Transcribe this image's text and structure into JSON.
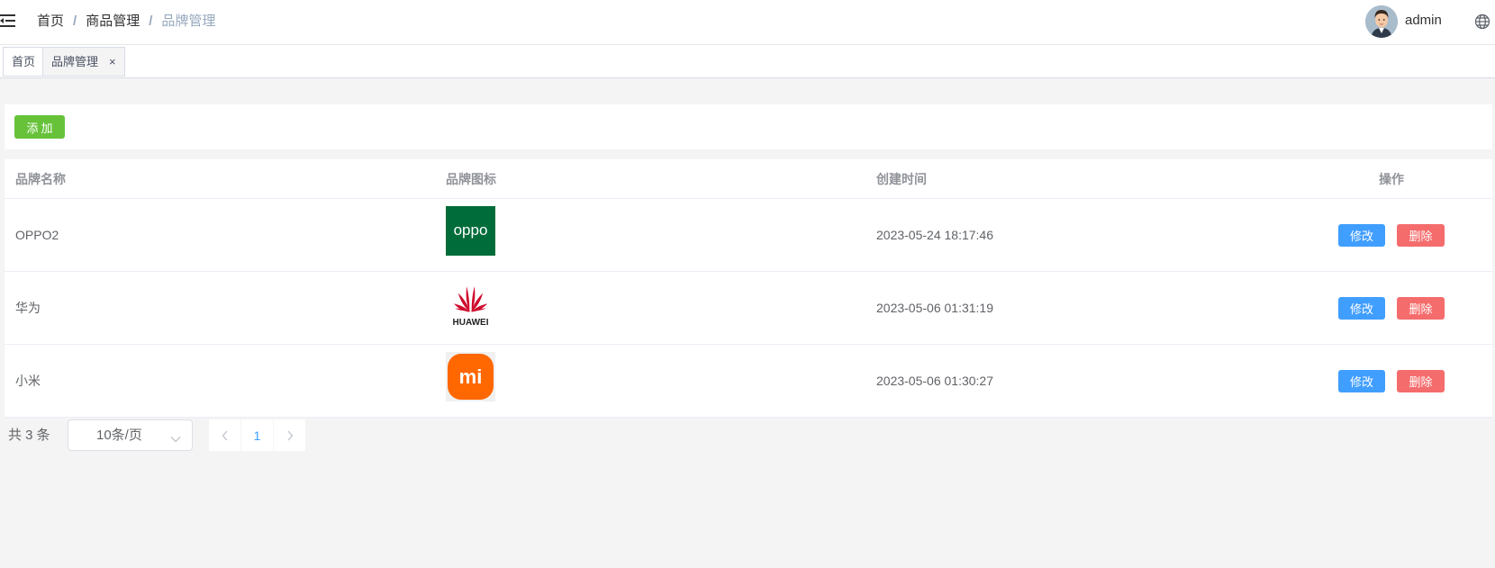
{
  "header": {
    "breadcrumb": [
      "首页",
      "商品管理",
      "品牌管理"
    ],
    "separator": "/",
    "username": "admin",
    "icons": {
      "menu": "hamburger-menu-icon",
      "language": "globe-icon",
      "avatar": "user-avatar"
    }
  },
  "tags": [
    {
      "label": "首页",
      "active": false
    },
    {
      "label": "品牌管理",
      "active": true,
      "close": "×"
    }
  ],
  "toolbar": {
    "add_label": "添加"
  },
  "table": {
    "columns": [
      "品牌名称",
      "品牌图标",
      "创建时间",
      "操作"
    ],
    "rows": [
      {
        "name": "OPPO2",
        "logo": "oppo-logo",
        "logo_text": "oppo",
        "created": "2023-05-24 18:17:46"
      },
      {
        "name": "华为",
        "logo": "huawei-logo",
        "logo_text": "HUAWEI",
        "created": "2023-05-06 01:31:19"
      },
      {
        "name": "小米",
        "logo": "xiaomi-logo",
        "logo_text": "mi",
        "created": "2023-05-06 01:30:27"
      }
    ],
    "actions": {
      "edit": "修改",
      "delete": "删除"
    }
  },
  "pagination": {
    "total_text": "共 3 条",
    "page_size": "10条/页",
    "current_page": "1",
    "prev": "‹",
    "next": "›"
  },
  "colors": {
    "primary": "#409eff",
    "success": "#67c23a",
    "danger": "#f56c6c",
    "oppo_green": "#006c3a",
    "huawei_red": "#cf0a2c",
    "xiaomi_orange": "#ff6700"
  }
}
